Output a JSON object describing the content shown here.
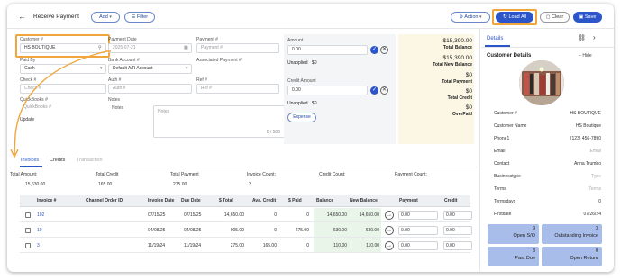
{
  "header": {
    "back_glyph": "←",
    "title": "Receive Payment",
    "add_label": "Add",
    "filter_label": "Filter",
    "action_label": "Action",
    "load_all_label": "Load All",
    "clear_label": "Clear",
    "save_label": "Save"
  },
  "form": {
    "customer_label": "Customer #",
    "customer_value": "HS BOUTIQUE",
    "payment_date_label": "Payment Date",
    "payment_date_value": "2025-07-21",
    "payment_no_label": "Payment #",
    "payment_no_placeholder": "Payment #",
    "paid_by_label": "Paid By",
    "paid_by_value": "Cash",
    "bank_account_label": "Bank Account #",
    "bank_account_value": "Default A/R Account",
    "associated_payment_label": "Associated Payment #",
    "check_label": "Check #",
    "check_placeholder": "Check #",
    "auth_label": "Auth #",
    "auth_placeholder": "Auth #",
    "ref_label": "Ref #",
    "ref_placeholder": "Ref #",
    "quickbooks_label": "QuickBooks #",
    "quickbooks_placeholder": "QuickBooks #",
    "update_label": "Update",
    "notes_label": "Notes",
    "notes_inner_label": "Notes",
    "notes_placeholder": "Notes",
    "notes_counter": "0 / 500"
  },
  "amount_panel": {
    "amount_label": "Amount",
    "amount_value": "0.00",
    "unapplied_label": "Unapplied",
    "unapplied_value": "$0",
    "credit_amount_label": "Credit Amount",
    "credit_amount_value": "0.00",
    "unapplied2_label": "Unapplied",
    "unapplied2_value": "$0",
    "expense_label": "Expense"
  },
  "totals": {
    "total_balance_value": "$15,390.00",
    "total_balance_label": "Total Balance",
    "total_new_balance_value": "$15,390.00",
    "total_new_balance_label": "Total New Balance",
    "total_payment_value": "$0",
    "total_payment_label": "Total Payment",
    "total_credit_value": "$0",
    "total_credit_label": "Total Credit",
    "overpaid_value": "$0",
    "overpaid_label": "OverPaid"
  },
  "tabs": [
    {
      "label": "Invoices"
    },
    {
      "label": "Credits"
    },
    {
      "label": "Transaction"
    }
  ],
  "summary": [
    {
      "label": "Total Amount:",
      "value": "15,630.00"
    },
    {
      "label": "Total Credit",
      "value": "165.00"
    },
    {
      "label": "Total Payment",
      "value": "275.00"
    },
    {
      "label": "Invoice Count:",
      "value": "3"
    },
    {
      "label": "Credit Count:",
      "value": ""
    },
    {
      "label": "Payment Count:",
      "value": ""
    }
  ],
  "table": {
    "headers": [
      "Invoice #",
      "Channel Order ID",
      "Invoice Date",
      "Due Date",
      "$ Total",
      "Ava. Credit",
      "$ Paid",
      "Balance",
      "New Balance",
      "Payment",
      "Credit"
    ],
    "rows": [
      {
        "invoice": "102",
        "channel": "",
        "invoice_date": "07/15/25",
        "due_date": "07/15/25",
        "total": "14,650.00",
        "ava_credit": "0",
        "paid": "0",
        "balance": "14,650.00",
        "new_balance": "14,650.00",
        "payment": "0.00",
        "credit": "0.00"
      },
      {
        "invoice": "10",
        "channel": "",
        "invoice_date": "04/08/25",
        "due_date": "04/08/25",
        "total": "905.00",
        "ava_credit": "0",
        "paid": "275.00",
        "balance": "630.00",
        "new_balance": "630.00",
        "payment": "0.00",
        "credit": "0.00"
      },
      {
        "invoice": "3",
        "channel": "",
        "invoice_date": "11/19/24",
        "due_date": "11/19/24",
        "total": "275.00",
        "ava_credit": "165.00",
        "paid": "0",
        "balance": "110.00",
        "new_balance": "110.00",
        "payment": "0.00",
        "credit": "0.00"
      }
    ]
  },
  "details": {
    "tab_label": "Details",
    "section_title": "Customer Details",
    "hide_label": "Hide",
    "fields": [
      {
        "label": "Customer #",
        "value": "HS BOUTIQUE",
        "muted": false
      },
      {
        "label": "Customer Name",
        "value": "HS Boutique",
        "muted": false
      },
      {
        "label": "Phone1",
        "value": "(123) 456-7890",
        "muted": false
      },
      {
        "label": "Email",
        "value": "Email",
        "muted": true
      },
      {
        "label": "Contact",
        "value": "Anna Trumbo",
        "muted": false
      },
      {
        "label": "Businesstype",
        "value": "Type",
        "muted": true
      },
      {
        "label": "Terms",
        "value": "Terms",
        "muted": true
      },
      {
        "label": "Termsdays",
        "value": "0",
        "muted": false
      },
      {
        "label": "Firstdate",
        "value": "07/26/24",
        "muted": false
      }
    ],
    "stats": [
      {
        "value": "9",
        "label": "Open S/O"
      },
      {
        "value": "3",
        "label": "Outstanding Invoice"
      },
      {
        "value": "3",
        "label": "Past Due"
      },
      {
        "value": "0",
        "label": "Open Return"
      }
    ]
  },
  "colors": {
    "accent": "#2b55c8",
    "highlight": "#f0a63c",
    "totals_bg": "#fbf7e4",
    "stat_bg": "#a9bdea"
  }
}
